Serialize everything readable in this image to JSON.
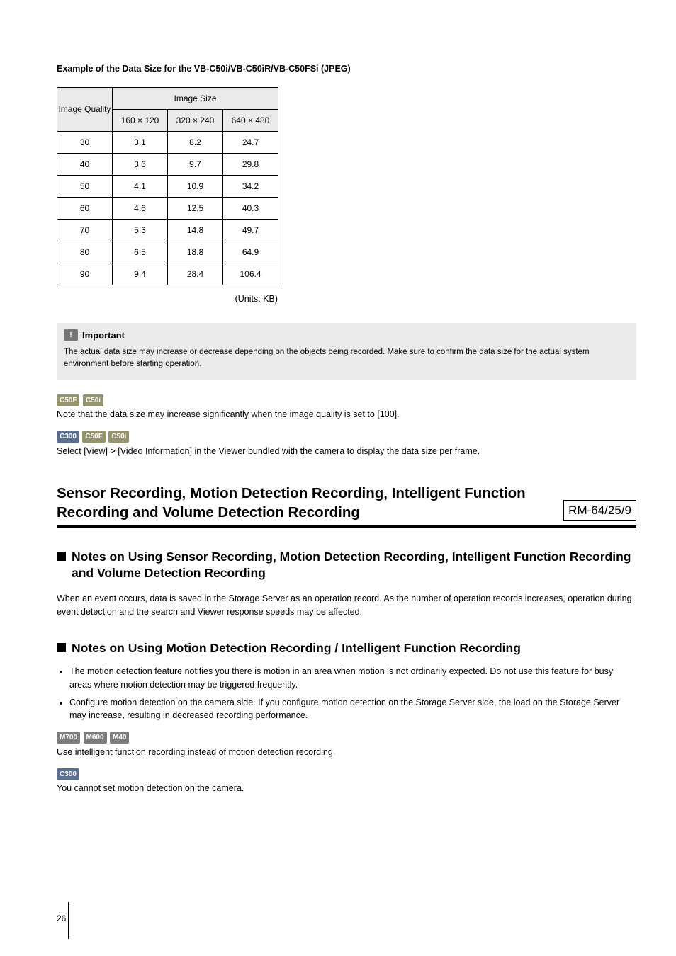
{
  "table_title": "Example of the Data Size for the VB-C50i/VB-C50iR/VB-C50FSi (JPEG)",
  "table": {
    "header_quality": "Image Quality",
    "header_size": "Image Size",
    "sizes": [
      "160 × 120",
      "320 × 240",
      "640 × 480"
    ],
    "rows": [
      {
        "q": "30",
        "v": [
          "3.1",
          "8.2",
          "24.7"
        ]
      },
      {
        "q": "40",
        "v": [
          "3.6",
          "9.7",
          "29.8"
        ]
      },
      {
        "q": "50",
        "v": [
          "4.1",
          "10.9",
          "34.2"
        ]
      },
      {
        "q": "60",
        "v": [
          "4.6",
          "12.5",
          "40.3"
        ]
      },
      {
        "q": "70",
        "v": [
          "5.3",
          "14.8",
          "49.7"
        ]
      },
      {
        "q": "80",
        "v": [
          "6.5",
          "18.8",
          "64.9"
        ]
      },
      {
        "q": "90",
        "v": [
          "9.4",
          "28.4",
          "106.4"
        ]
      }
    ]
  },
  "units": "(Units: KB)",
  "important": {
    "label": "Important",
    "text": "The actual data size may increase or decrease depending on the objects being recorded. Make sure to confirm the data size for the actual system environment before starting operation."
  },
  "note1": {
    "badges": [
      "C50F",
      "C50i"
    ],
    "text": "Note that the data size may increase significantly when the image quality is set to [100]."
  },
  "note2": {
    "badges": [
      "C300",
      "C50F",
      "C50i"
    ],
    "text": "Select [View] > [Video Information] in the Viewer bundled with the camera to display the data size per frame."
  },
  "section": {
    "title": "Sensor Recording, Motion Detection Recording, Intelligent Function Recording and Volume Detection Recording",
    "rm": "RM-64/25/9"
  },
  "sub1": {
    "title": "Notes on Using Sensor Recording, Motion Detection Recording, Intelligent Function Recording and Volume Detection Recording",
    "text": "When an event occurs, data is saved in the Storage Server as an operation record. As the number of operation records increases, operation during event detection and the search and Viewer response speeds may be affected."
  },
  "sub2": {
    "title": "Notes on Using Motion Detection Recording / Intelligent Function Recording",
    "bullets": [
      "The motion detection feature notifies you there is motion in an area when motion is not ordinarily expected. Do not use this feature for busy areas where motion detection may be triggered frequently.",
      "Configure motion detection on the camera side. If you configure motion detection on the Storage Server side, the load on the Storage Server may increase, resulting in decreased recording performance."
    ],
    "note_a": {
      "badges": [
        "M700",
        "M600",
        "M40"
      ],
      "text": "Use intelligent function recording instead of motion detection recording."
    },
    "note_b": {
      "badges": [
        "C300"
      ],
      "text": "You cannot set motion detection on the camera."
    }
  },
  "page": "26",
  "chart_data": {
    "type": "table",
    "title": "Example of the Data Size for the VB-C50i/VB-C50iR/VB-C50FSi (JPEG)",
    "xlabel": "Image Size",
    "ylabel": "Image Quality",
    "units": "KB",
    "categories": [
      "160 × 120",
      "320 × 240",
      "640 × 480"
    ],
    "series": [
      {
        "name": "30",
        "values": [
          3.1,
          8.2,
          24.7
        ]
      },
      {
        "name": "40",
        "values": [
          3.6,
          9.7,
          29.8
        ]
      },
      {
        "name": "50",
        "values": [
          4.1,
          10.9,
          34.2
        ]
      },
      {
        "name": "60",
        "values": [
          4.6,
          12.5,
          40.3
        ]
      },
      {
        "name": "70",
        "values": [
          5.3,
          14.8,
          49.7
        ]
      },
      {
        "name": "80",
        "values": [
          6.5,
          18.8,
          64.9
        ]
      },
      {
        "name": "90",
        "values": [
          9.4,
          28.4,
          106.4
        ]
      }
    ]
  }
}
